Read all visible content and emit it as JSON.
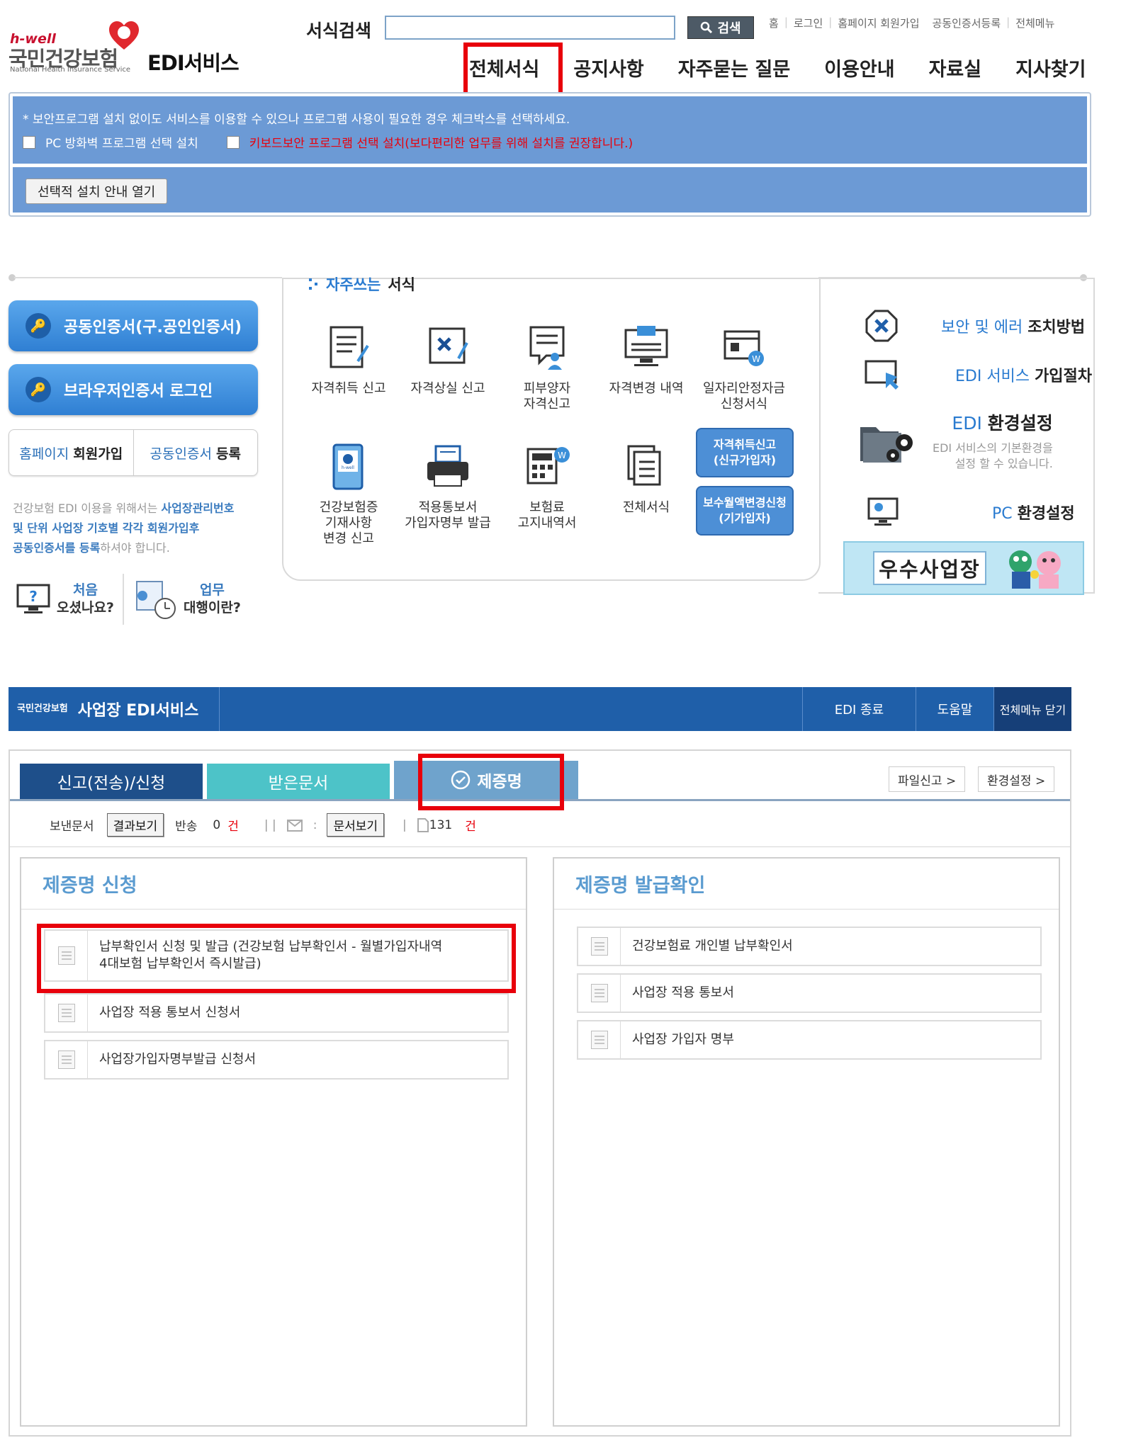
{
  "header": {
    "logo_hwell": "h-well",
    "logo_name": "국민건강보험",
    "logo_en": "National Health Insurance Service",
    "service_title": "EDI서비스",
    "search_label": "서식검색",
    "search_value": "",
    "search_button": "검색",
    "util_links": [
      "홈",
      "로그인",
      "홈페이지 회원가입",
      "공동인증서등록",
      "전체메뉴"
    ],
    "nav": [
      "전체서식",
      "공지사항",
      "자주묻는 질문",
      "이용안내",
      "자료실",
      "지사찾기"
    ]
  },
  "notice": {
    "text": "* 보안프로그램 설치 없이도 서비스를 이용할 수 있으나 프로그램 사용이 필요한 경우 체크박스를 선택하세요.",
    "checkbox_firewall": "PC 방화벽 프로그램 선택 설치",
    "checkbox_keyboard": "키보드보안 프로그램 선택 설치(보다편리한 업무를 위해 설치를 권장합니다.)",
    "guide_button": "선택적 설치 안내 열기"
  },
  "left": {
    "cert_button": "공동인증서(구.공인인증서)",
    "browser_button": "브라우저인증서 로그인",
    "signup": {
      "blue": "홈페이지",
      "bold": "회원가입"
    },
    "register": {
      "blue": "공동인증서",
      "bold": "등록"
    },
    "info_line1_a": "건강보험 EDI 이용을 위해서는 ",
    "info_line1_b": "사업장관리번호",
    "info_line2": "및 단위 사업장 기호별 각각 회원가입후",
    "info_line3_a": "공동인증서를 등록",
    "info_line3_b": "하셔야 합니다.",
    "help1_a": "처음",
    "help1_b": "오셨나요?",
    "help2_a": "업무",
    "help2_b": "대행이란?"
  },
  "frequent": {
    "title_a": "자주쓰는",
    "title_b": "서식",
    "tiles": [
      {
        "label": "자격취득 신고"
      },
      {
        "label": "자격상실 신고"
      },
      {
        "label": "피부양자\n자격신고"
      },
      {
        "label": "자격변경 내역"
      },
      {
        "label": "일자리안정자금\n신청서식"
      },
      {
        "label": "건강보험증\n기재사항\n변경 신고"
      },
      {
        "label": "적용통보서\n가입자명부 발급"
      },
      {
        "label": "보험료\n고지내역서"
      },
      {
        "label": "전체서식"
      }
    ],
    "pill1": "자격취득신고\n(신규가입자)",
    "pill2": "보수월액변경신청\n(기가입자)"
  },
  "right": {
    "row1_a": "보안 및 에러",
    "row1_b": "조치방법",
    "row2_a": "EDI 서비스",
    "row2_b": "가입절차",
    "row3_a": "EDI",
    "row3_b": "환경설정",
    "row3_sub": "EDI 서비스의 기본환경을\n설정 할 수 있습니다.",
    "row4_a": "PC",
    "row4_b": "환경설정",
    "award": "우수사업장"
  },
  "edi": {
    "mini_logo": "국민건강보험",
    "title": "사업장 EDI서비스",
    "actions": [
      "EDI 종료",
      "도움말",
      "전체메뉴 닫기"
    ],
    "tabs": [
      "신고(전송)/신청",
      "받은문서",
      "제증명"
    ],
    "file_report": "파일신고 >",
    "env_setting": "환경설정 >",
    "sent_label": "보낸문서",
    "result_button": "결과보기",
    "return_label": "반송",
    "return_count": "0",
    "unit": "건",
    "doc_view_button": "문서보기",
    "doc_count": "131",
    "left_title": "제증명 신청",
    "left_items": [
      "납부확인서 신청 및 발급 (건강보험 납부확인서 - 월별가입자내역\n4대보험 납부확인서 즉시발급)",
      "사업장 적용 통보서 신청서",
      "사업장가입자명부발급 신청서"
    ],
    "right_title": "제증명 발급확인",
    "right_items": [
      "건강보험료 개인별 납부확인서",
      "사업장 적용 통보서",
      "사업장 가입자 명부"
    ]
  }
}
